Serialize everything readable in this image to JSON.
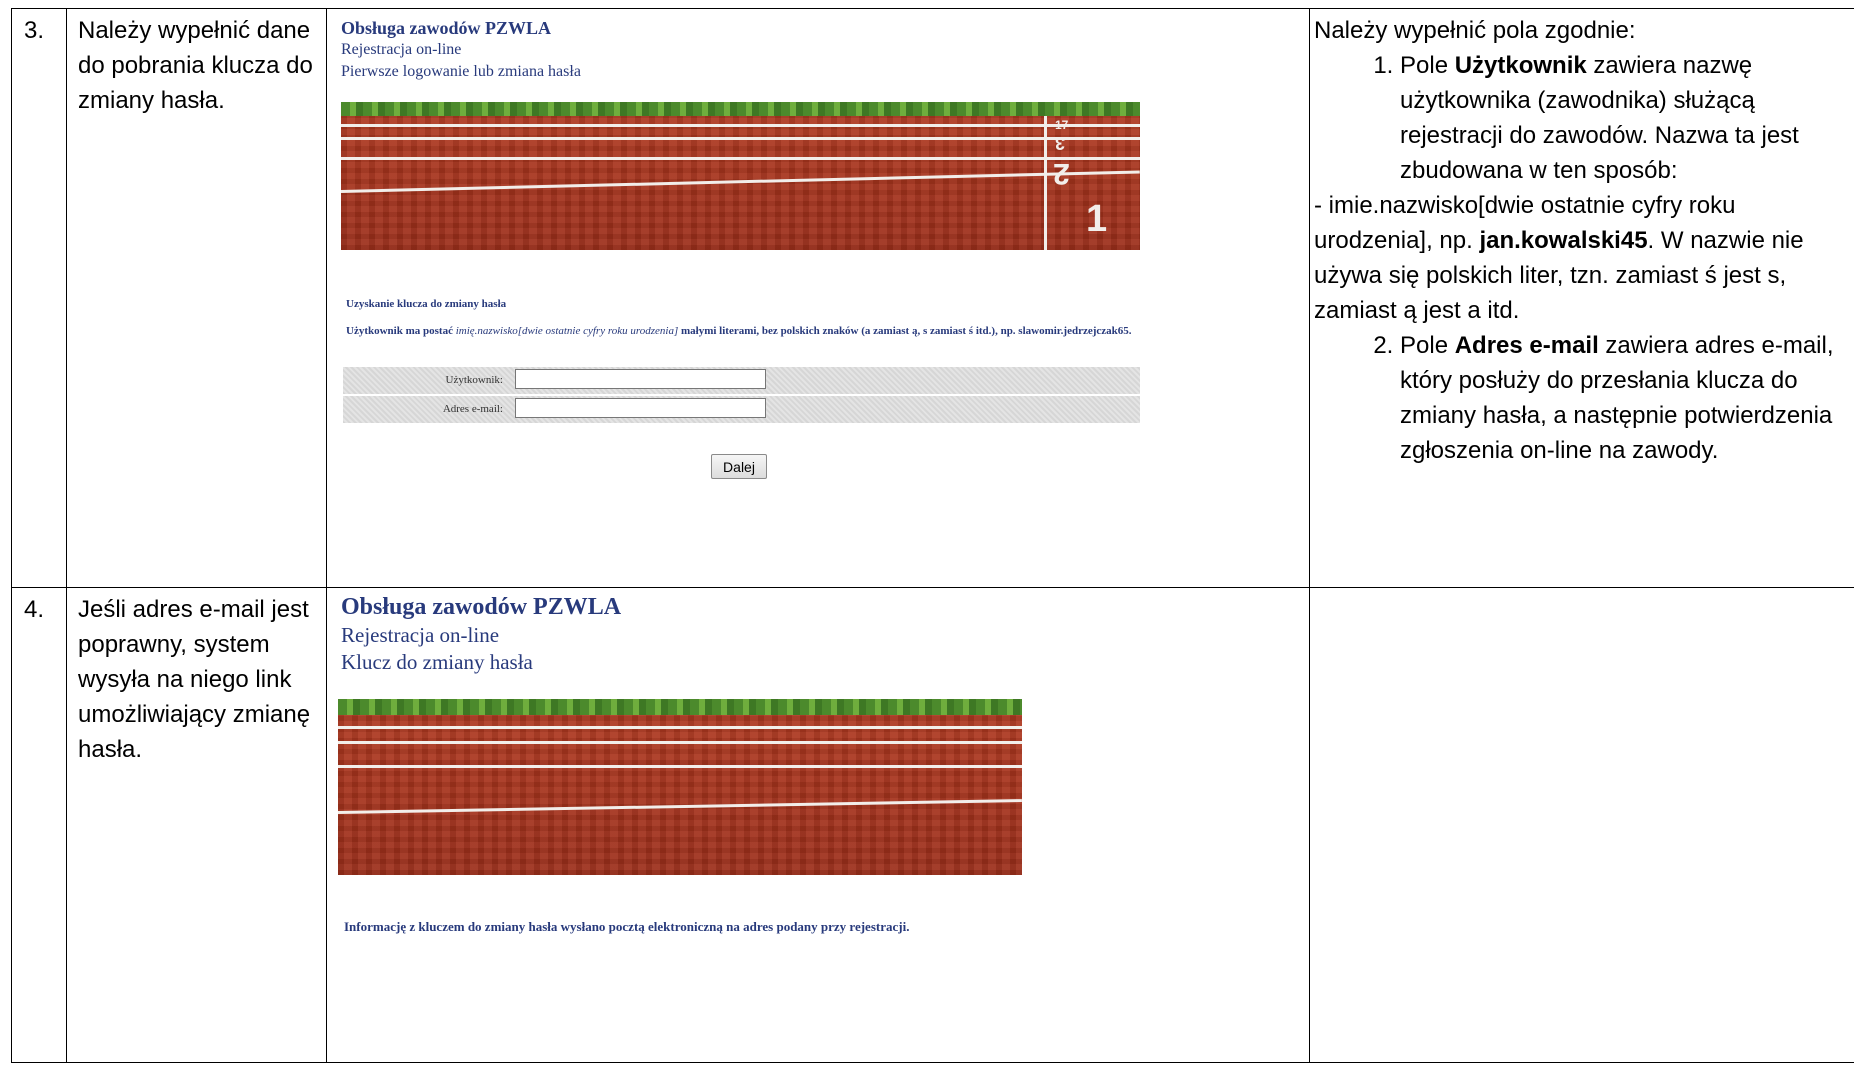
{
  "row3": {
    "number": "3.",
    "description": "Należy wypełnić dane do pobrania klucza do zmiany hasła.",
    "screenshot": {
      "title": "Obsługa zawodów PZWLA",
      "subtitle": "Rejestracja on-line",
      "page_name": "Pierwsze logowanie lub zmiana hasła",
      "track_numbers": [
        "17",
        "3",
        "2",
        "1"
      ],
      "section_heading": "Uzyskanie klucza do zmiany hasła",
      "instruction_prefix": "Użytkownik ma postać ",
      "instruction_format": "imię.nazwisko[dwie ostatnie cyfry roku urodzenia]",
      "instruction_suffix": " małymi literami, bez polskich znaków (a zamiast ą, s zamiast ś itd.), np. slawomir.jedrzejczak65.",
      "fields": [
        {
          "label": "Użytkownik:",
          "value": ""
        },
        {
          "label": "Adres e-mail:",
          "value": ""
        }
      ],
      "submit_label": "Dalej"
    },
    "notes": {
      "intro": "Należy wypełnić pola zgodnie:",
      "item1_prefix": "Pole ",
      "item1_bold": "Użytkownik",
      "item1_text": " zawiera nazwę użytkownika (zawodnika) służącą rejestracji do zawodów. Nazwa ta jest zbudowana w ten sposób:",
      "para_prefix": "- imie.nazwisko[dwie ostatnie cyfry roku urodzenia], np. ",
      "para_bold": "jan.kowalski45",
      "para_suffix": ". W nazwie nie używa się polskich liter, tzn. zamiast ś jest s, zamiast ą jest a itd.",
      "item2_prefix": "Pole ",
      "item2_bold": "Adres e-mail",
      "item2_text": " zawiera adres e-mail, który posłuży do przesłania klucza do zmiany hasła, a następnie potwierdzenia zgłoszenia on-line na zawody."
    }
  },
  "row4": {
    "number": "4.",
    "description": "Jeśli adres e-mail jest poprawny, system wysyła na niego link umożliwiający zmianę hasła.",
    "screenshot": {
      "title": "Obsługa zawodów PZWLA",
      "subtitle": "Rejestracja on-line",
      "page_name": "Klucz do zmiany hasła",
      "message": "Informację z kluczem do zmiany hasła wysłano pocztą elektroniczną na adres podany przy rejestracji."
    },
    "notes": ""
  }
}
